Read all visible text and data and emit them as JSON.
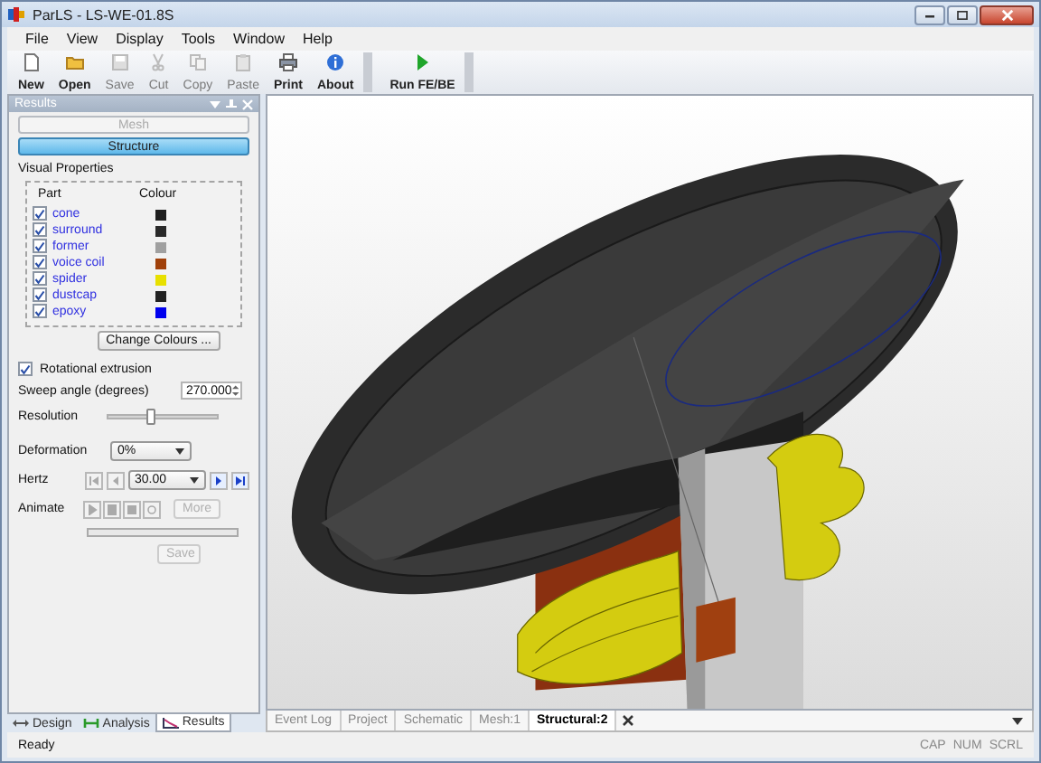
{
  "window": {
    "title": "ParLS - LS-WE-01.8S"
  },
  "menu": [
    "File",
    "View",
    "Display",
    "Tools",
    "Window",
    "Help"
  ],
  "toolbar": {
    "groups": [
      {
        "items": [
          {
            "label": "New",
            "disabled": false
          },
          {
            "label": "Open",
            "disabled": false
          },
          {
            "label": "Save",
            "disabled": true
          },
          {
            "label": "Cut",
            "disabled": true
          },
          {
            "label": "Copy",
            "disabled": true
          },
          {
            "label": "Paste",
            "disabled": true
          },
          {
            "label": "Print",
            "disabled": false
          },
          {
            "label": "About",
            "disabled": false
          }
        ]
      },
      {
        "items": [
          {
            "label": "Run FE/BE",
            "disabled": false
          }
        ]
      }
    ]
  },
  "panel": {
    "title": "Results",
    "modes": [
      {
        "label": "Mesh",
        "selected": false,
        "disabled": true
      },
      {
        "label": "Structure",
        "selected": true,
        "disabled": false
      }
    ],
    "visual_properties": {
      "title": "Visual Properties",
      "columns": [
        "Part",
        "Colour"
      ],
      "parts": [
        {
          "name": "cone",
          "checked": true,
          "color": "#1e1e1e"
        },
        {
          "name": "surround",
          "checked": true,
          "color": "#2a2a2a"
        },
        {
          "name": "former",
          "checked": true,
          "color": "#a0a0a0"
        },
        {
          "name": "voice coil",
          "checked": true,
          "color": "#a0400a"
        },
        {
          "name": "spider",
          "checked": true,
          "color": "#e8e000"
        },
        {
          "name": "dustcap",
          "checked": true,
          "color": "#222222"
        },
        {
          "name": "epoxy",
          "checked": true,
          "color": "#0000ee"
        }
      ]
    },
    "change_colours": "Change Colours ...",
    "rotational_extrusion": {
      "label": "Rotational extrusion",
      "checked": true
    },
    "sweep_angle": {
      "label": "Sweep angle (degrees)",
      "value": "270.000"
    },
    "resolution": {
      "label": "Resolution",
      "level": 0.38
    },
    "deformation": {
      "label": "Deformation",
      "value": "0%"
    },
    "hertz": {
      "label": "Hertz",
      "value": "30.00",
      "buttons": [
        {
          "disabled": true
        },
        {
          "disabled": true
        },
        {
          "disabled": false
        },
        {
          "disabled": false
        }
      ]
    },
    "animate": {
      "label": "Animate",
      "buttons": [
        {
          "disabled": true
        },
        {
          "disabled": true
        },
        {
          "disabled": true
        },
        {
          "disabled": true
        }
      ],
      "more": {
        "label": "More",
        "disabled": true
      },
      "progress": {
        "level": 0
      },
      "save": {
        "label": "Save",
        "disabled": true
      }
    }
  },
  "left_tabs": [
    {
      "label": "Design",
      "selected": false
    },
    {
      "label": "Analysis",
      "selected": false
    },
    {
      "label": "Results",
      "selected": true
    }
  ],
  "doc_tabs": [
    {
      "label": "Event Log",
      "selected": false
    },
    {
      "label": "Project",
      "selected": false
    },
    {
      "label": "Schematic",
      "selected": false
    },
    {
      "label": "Mesh:1",
      "selected": false
    },
    {
      "label": "Structural:2",
      "selected": true
    }
  ],
  "status_bar": {
    "text": "Ready",
    "indicators": [
      "CAP",
      "NUM",
      "SCRL"
    ]
  }
}
